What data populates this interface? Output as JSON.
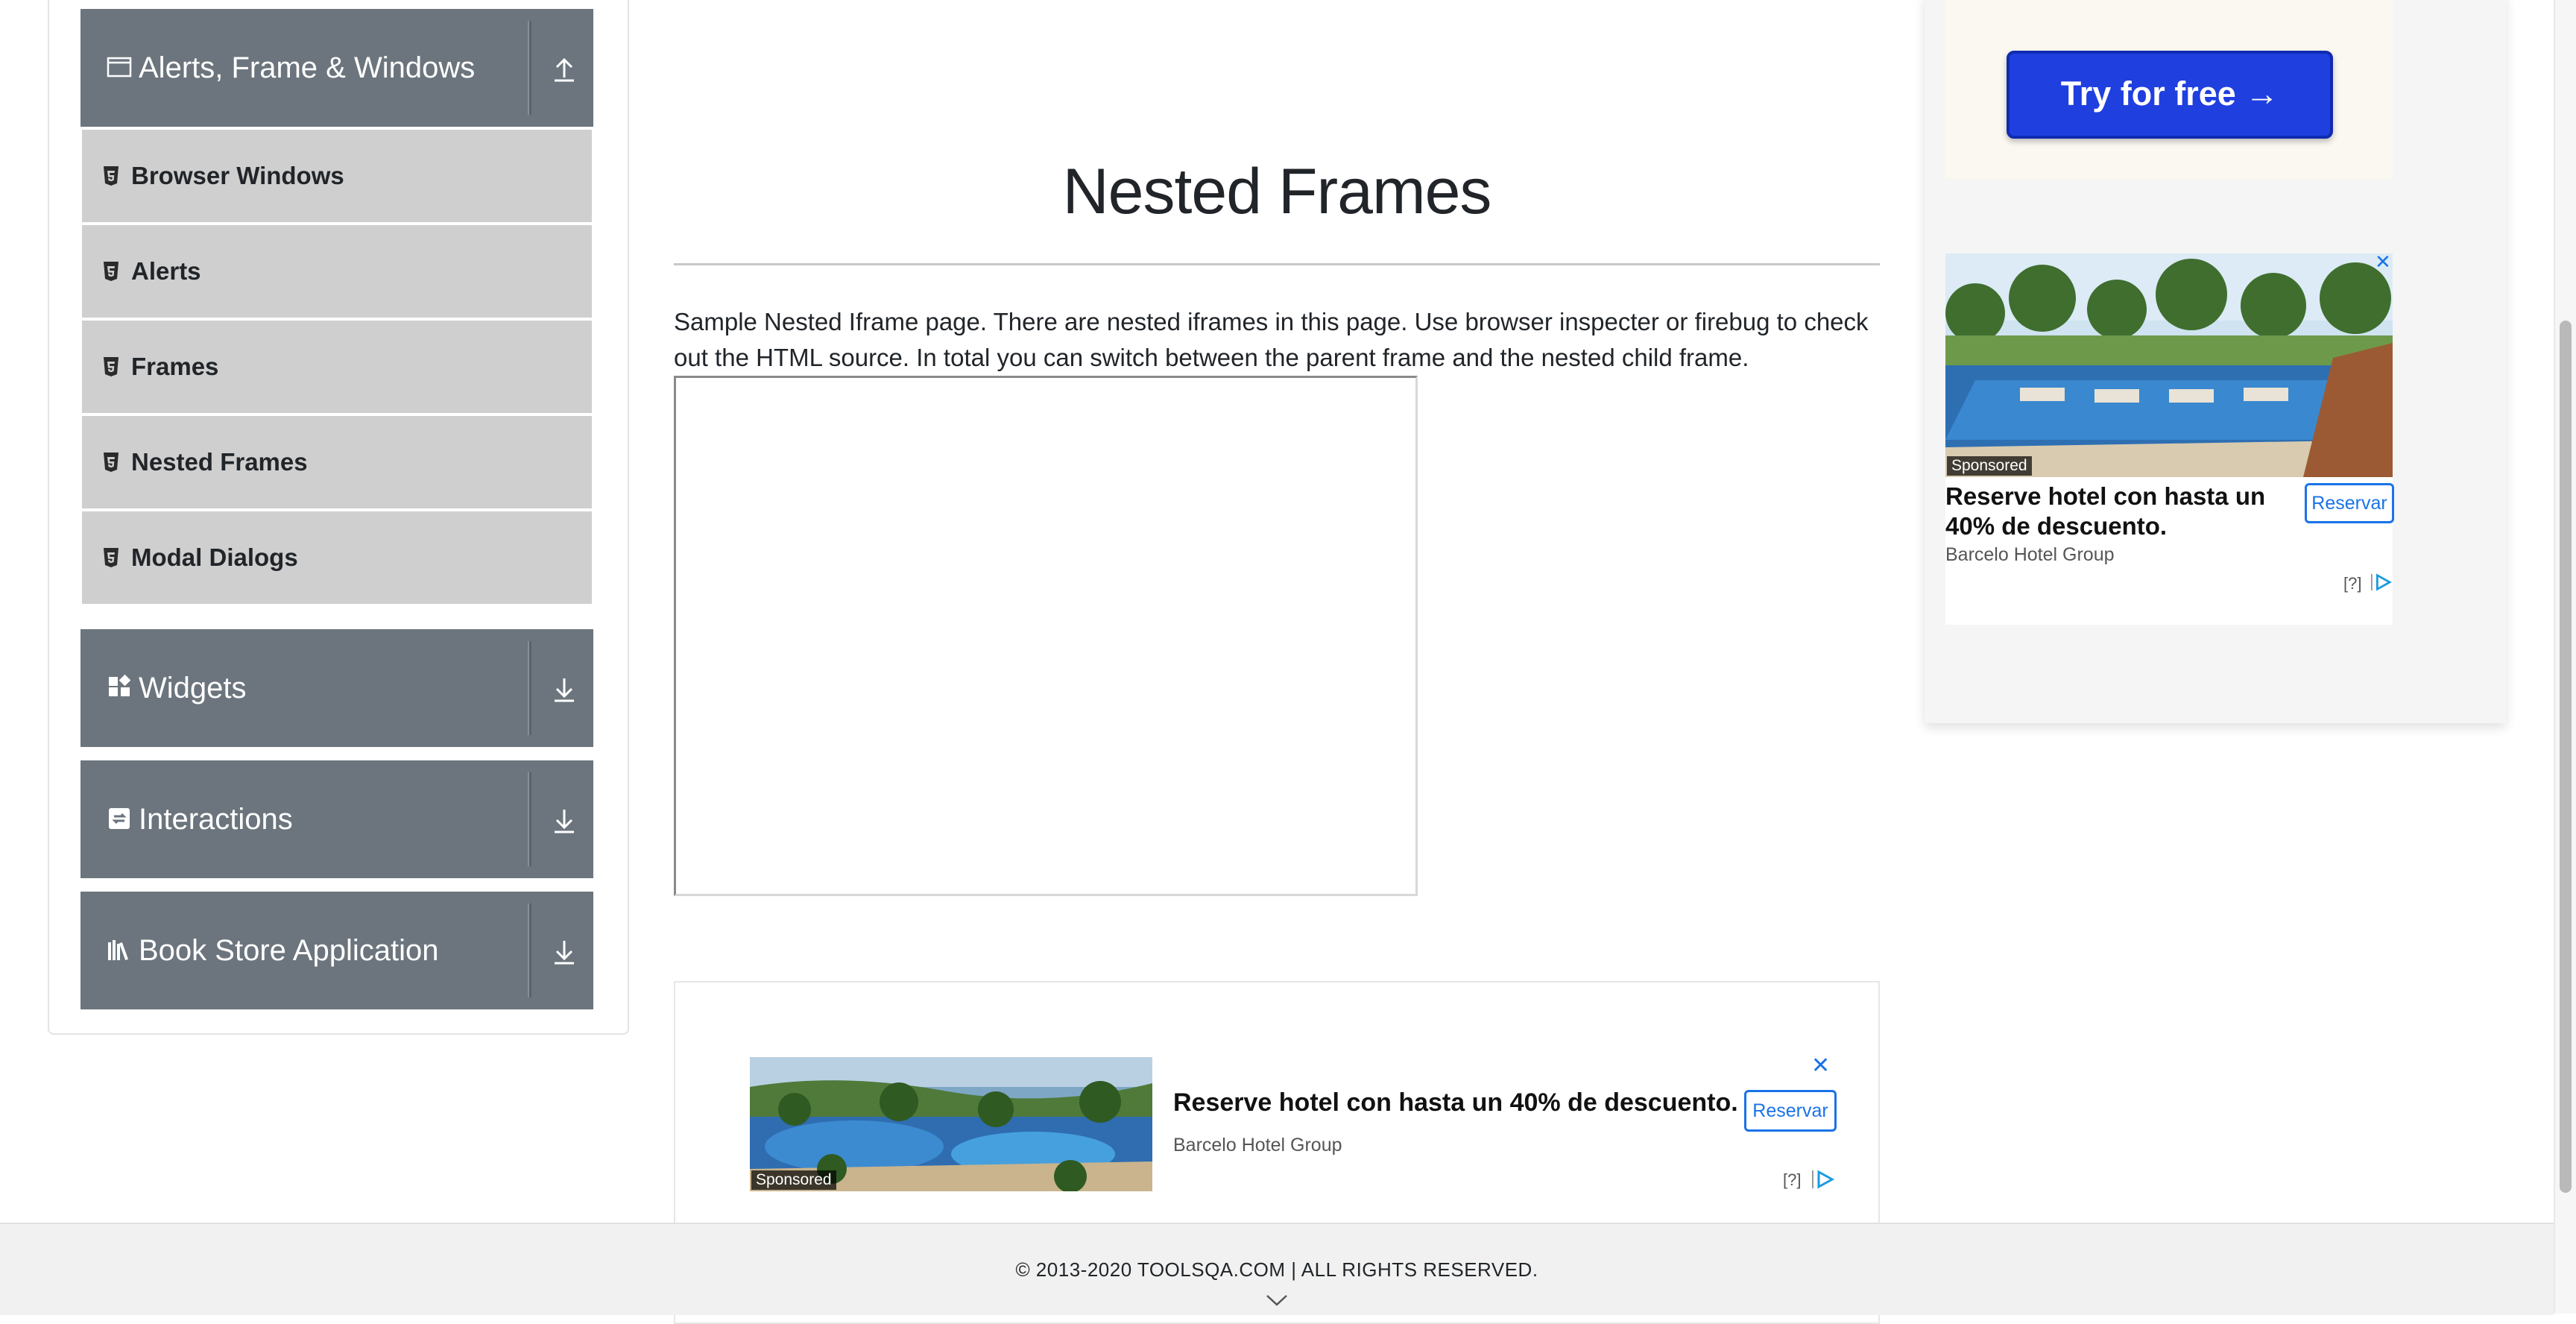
{
  "sidebar": {
    "groups": [
      {
        "label": "Alerts, Frame & Windows",
        "icon": "window-icon",
        "state": "expanded"
      },
      {
        "label": "Widgets",
        "icon": "widgets-icon",
        "state": "collapsed"
      },
      {
        "label": "Interactions",
        "icon": "interactions-icon",
        "state": "collapsed"
      },
      {
        "label": "Book Store Application",
        "icon": "books-icon",
        "state": "collapsed"
      }
    ],
    "items": [
      {
        "label": "Browser Windows"
      },
      {
        "label": "Alerts"
      },
      {
        "label": "Frames"
      },
      {
        "label": "Nested Frames"
      },
      {
        "label": "Modal Dialogs"
      }
    ]
  },
  "main": {
    "title": "Nested Frames",
    "intro": "Sample Nested Iframe page. There are nested iframes in this page. Use browser inspecter or firebug to check out the HTML source. In total you can switch between the parent frame and the nested child frame."
  },
  "ads": {
    "top_cta": "Try for free →",
    "side": {
      "sponsored": "Sponsored",
      "headline": "Reserve hotel con hasta un 40% de descuento.",
      "brand": "Barcelo Hotel Group",
      "button": "Reservar",
      "info": "[?]"
    },
    "bottom": {
      "sponsored": "Sponsored",
      "headline": "Reserve hotel con hasta un 40% de descuento.",
      "brand": "Barcelo Hotel Group",
      "button": "Reservar",
      "info": "[?]"
    }
  },
  "footer": {
    "copyright": "© 2013-2020 TOOLSQA.COM | ALL RIGHTS RESERVED."
  },
  "colors": {
    "group_header": "#6c757d",
    "menu_item": "#cfcfcf",
    "cta_blue": "#1f3fdf",
    "ad_link_blue": "#1a73e8"
  }
}
